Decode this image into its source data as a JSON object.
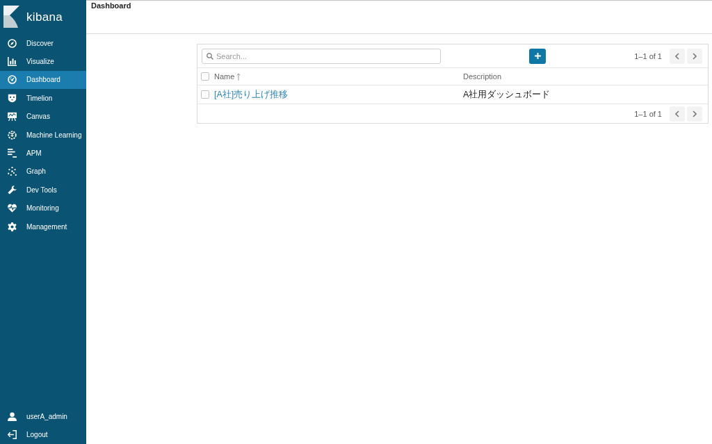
{
  "sidebar": {
    "logo_text": "kibana",
    "items": [
      {
        "label": "Discover",
        "selected": false
      },
      {
        "label": "Visualize",
        "selected": false
      },
      {
        "label": "Dashboard",
        "selected": true
      },
      {
        "label": "Timelion",
        "selected": false
      },
      {
        "label": "Canvas",
        "selected": false
      },
      {
        "label": "Machine Learning",
        "selected": false
      },
      {
        "label": "APM",
        "selected": false
      },
      {
        "label": "Graph",
        "selected": false
      },
      {
        "label": "Dev Tools",
        "selected": false
      },
      {
        "label": "Monitoring",
        "selected": false
      },
      {
        "label": "Management",
        "selected": false
      }
    ],
    "account_items": [
      {
        "label": "userA_admin"
      },
      {
        "label": "Logout"
      }
    ]
  },
  "header": {
    "title": "Dashboard"
  },
  "table": {
    "search": {
      "placeholder": "Search..."
    },
    "pagination_top": {
      "text": "1–1 of 1"
    },
    "select_all": {
      "checked": false
    },
    "columns": [
      {
        "label": "Name",
        "sorted": true
      },
      {
        "label": "Description",
        "sorted": false
      }
    ],
    "rows": [
      {
        "name": "[A社]売り上げ推移",
        "description": "A社用ダッシュボード",
        "checked": false
      }
    ],
    "pagination_bottom": {
      "text": "1–1 of 1"
    }
  }
}
